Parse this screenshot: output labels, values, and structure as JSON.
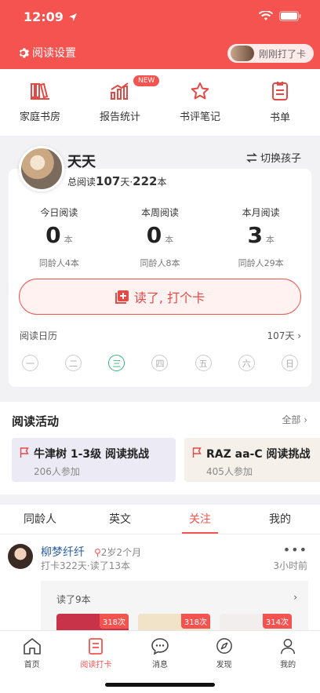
{
  "status_bar": {
    "time": "12:09"
  },
  "header": {
    "settings_label": "阅读设置",
    "just_checked": "刚刚打了卡",
    "accent_color": "#f5534f"
  },
  "quick_nav": [
    {
      "label": "家庭书房",
      "icon": "bookshelf-icon"
    },
    {
      "label": "报告统计",
      "icon": "bar-chart-icon",
      "badge": "NEW"
    },
    {
      "label": "书评笔记",
      "icon": "star-icon"
    },
    {
      "label": "书单",
      "icon": "list-icon"
    }
  ],
  "profile": {
    "name": "天天",
    "switch_label": "切换孩子",
    "total_prefix": "总阅读",
    "total_days": "107",
    "days_unit": "天·",
    "total_books": "222",
    "books_unit": "本"
  },
  "stats": [
    {
      "label": "今日阅读",
      "value": "0",
      "unit": "本",
      "peer": "同龄人4本"
    },
    {
      "label": "本周阅读",
      "value": "0",
      "unit": "本",
      "peer": "同龄人8本"
    },
    {
      "label": "本月阅读",
      "value": "3",
      "unit": "本",
      "peer": "同龄人29本"
    }
  ],
  "checkin_button": "读了, 打个卡",
  "calendar": {
    "label": "阅读日历",
    "days": "107天",
    "weekdays": [
      "一",
      "二",
      "三",
      "四",
      "五",
      "六",
      "日"
    ],
    "today_index": 2
  },
  "activity": {
    "title": "阅读活动",
    "all_label": "全部",
    "items": [
      {
        "title": "牛津树 1-3级 阅读挑战",
        "participants": "206人参加",
        "bg": "#ecebf5"
      },
      {
        "title": "RAZ aa-C 阅读挑战",
        "participants": "405人参加",
        "bg": "#f5f0e9"
      }
    ]
  },
  "tabs": [
    {
      "label": "同龄人"
    },
    {
      "label": "英文"
    },
    {
      "label": "关注",
      "active": true
    },
    {
      "label": "我的"
    }
  ],
  "feed": {
    "name": "柳梦纤纤",
    "age": "2岁2个月",
    "meta": "打卡322天·读了13本",
    "time": "3小时前",
    "read_count": "读了9本",
    "books": [
      {
        "badge": "318次",
        "color": "#c9334a"
      },
      {
        "badge": "318次",
        "color": "#f1e3c7"
      },
      {
        "badge": "314次",
        "color": "#f3eeee"
      }
    ]
  },
  "bottom_nav": [
    {
      "label": "首页",
      "icon": "home-icon"
    },
    {
      "label": "阅读打卡",
      "icon": "checkin-icon",
      "active": true
    },
    {
      "label": "消息",
      "icon": "message-icon"
    },
    {
      "label": "发现",
      "icon": "compass-icon"
    },
    {
      "label": "我的",
      "icon": "user-icon"
    }
  ]
}
